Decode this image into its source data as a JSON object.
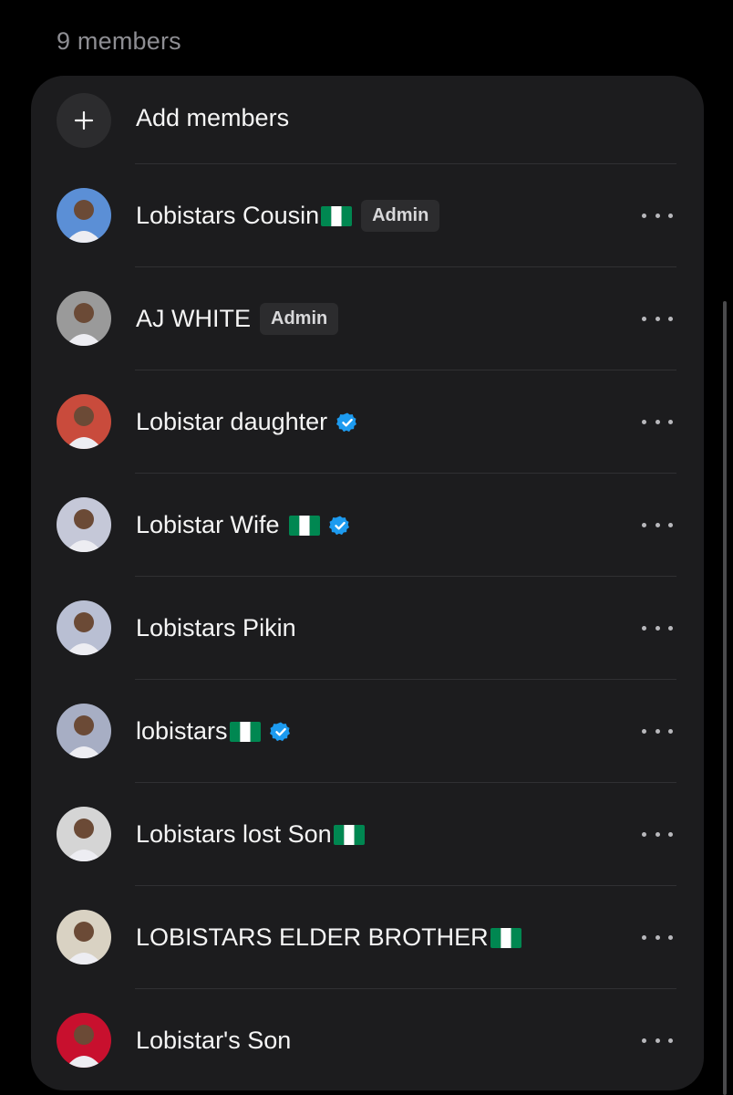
{
  "header": {
    "member_count_label": "9 members"
  },
  "add_members": {
    "label": "Add members",
    "icon": "plus-icon"
  },
  "members": [
    {
      "name": "Lobistars Cousin",
      "flag": true,
      "flag_tight": true,
      "verified": false,
      "badge": "Admin",
      "avatar_color": "#5b8fd6"
    },
    {
      "name": "AJ WHITE",
      "flag": false,
      "verified": false,
      "badge": "Admin",
      "avatar_color": "#9a9a9a"
    },
    {
      "name": "Lobistar daughter",
      "flag": false,
      "verified": true,
      "badge": "",
      "avatar_color": "#c94b3c"
    },
    {
      "name": "Lobistar Wife",
      "flag": true,
      "flag_tight": false,
      "verified": true,
      "badge": "",
      "avatar_color": "#c5c8d8"
    },
    {
      "name": "Lobistars Pikin",
      "flag": false,
      "verified": false,
      "badge": "",
      "avatar_color": "#b9bfd3"
    },
    {
      "name": "lobistars",
      "flag": true,
      "flag_tight": true,
      "verified": true,
      "badge": "",
      "avatar_color": "#a7aec4"
    },
    {
      "name": "Lobistars lost Son",
      "flag": true,
      "flag_tight": true,
      "verified": false,
      "badge": "",
      "avatar_color": "#d5d5d5"
    },
    {
      "name": "LOBISTARS ELDER BROTHER",
      "flag": true,
      "flag_tight": true,
      "verified": false,
      "badge": "",
      "avatar_color": "#d9d2c3"
    },
    {
      "name": "Lobistar's Son",
      "flag": false,
      "verified": false,
      "badge": "",
      "avatar_color": "#c8102e"
    }
  ],
  "colors": {
    "background": "#000000",
    "card": "#1c1c1e",
    "verified_blue": "#1d9bf0",
    "flag_green": "#008751"
  }
}
